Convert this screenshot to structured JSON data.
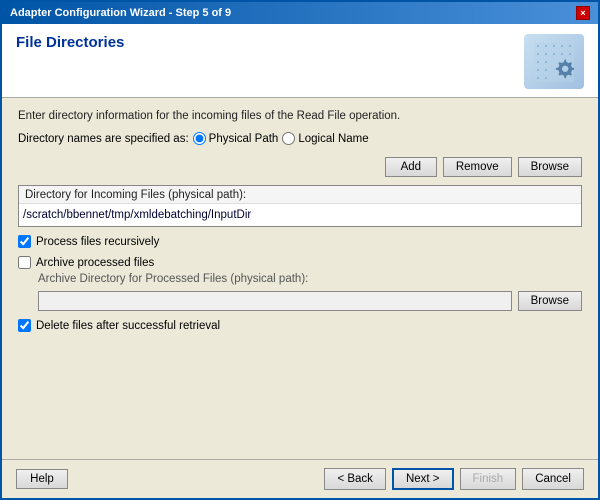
{
  "window": {
    "title": "Adapter Configuration Wizard - Step 5 of 9",
    "close_label": "×"
  },
  "header": {
    "title": "File Directories",
    "icon_alt": "gear-icon"
  },
  "info": {
    "line1": "Enter directory information for the incoming files of the Read File operation.",
    "line2": "Directory names are specified as:"
  },
  "radio": {
    "physical_path_label": "Physical Path",
    "logical_name_label": "Logical Name",
    "selected": "physical"
  },
  "buttons": {
    "add": "Add",
    "remove": "Remove",
    "browse": "Browse",
    "browse_archive": "Browse"
  },
  "directory_section": {
    "label": "Directory for Incoming Files (physical path):",
    "value": "/scratch/bbennet/tmp/xmldebatching/InputDir"
  },
  "checkboxes": {
    "process_recursively_label": "Process files recursively",
    "process_recursively_checked": true,
    "archive_label": "Archive processed files",
    "archive_checked": false,
    "delete_label": "Delete files after successful retrieval",
    "delete_checked": true
  },
  "archive": {
    "label": "Archive Directory for Processed Files (physical path):",
    "value": ""
  },
  "footer": {
    "help": "Help",
    "back": "< Back",
    "next": "Next >",
    "finish": "Finish",
    "cancel": "Cancel"
  }
}
